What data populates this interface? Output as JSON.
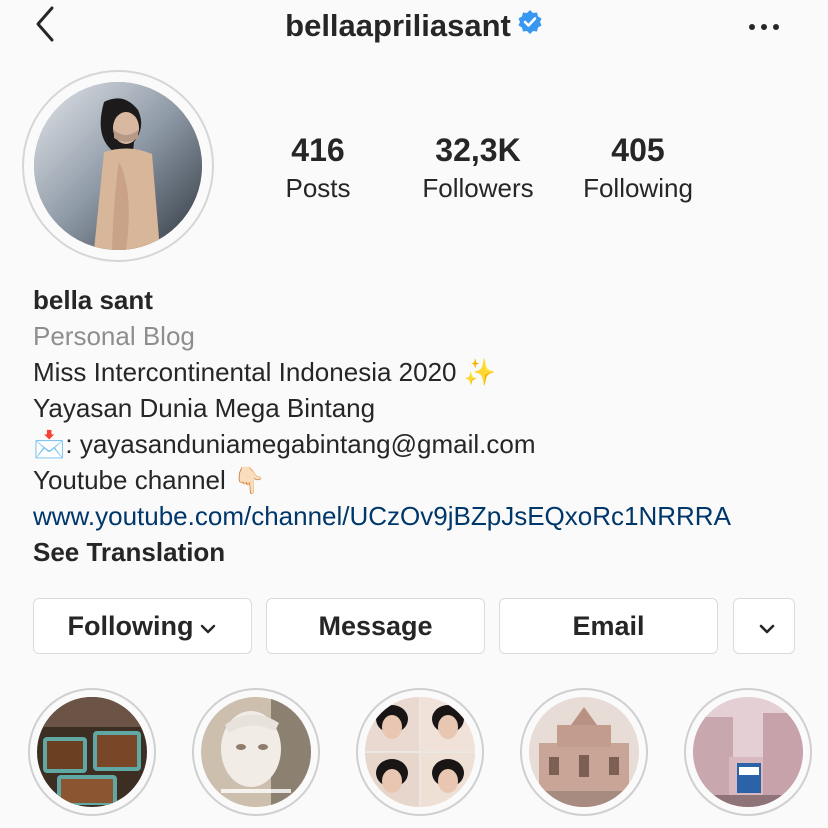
{
  "header": {
    "username": "bellaapriliasant",
    "back_icon": "chevron-left-icon",
    "verified_icon": "verified-badge-icon",
    "more_icon": "more-horizontal-icon",
    "accent_color": "#3897f0"
  },
  "stats": [
    {
      "value": "416",
      "label": "Posts"
    },
    {
      "value": "32,3K",
      "label": "Followers"
    },
    {
      "value": "405",
      "label": "Following"
    }
  ],
  "bio": {
    "name": "bella sant",
    "category": "Personal Blog",
    "line1": "Miss Intercontinental Indonesia 2020 ✨",
    "line2": "Yayasan Dunia Mega Bintang",
    "line3": "📩: yayasanduniamegabintang@gmail.com",
    "line4": "Youtube channel 👇🏻",
    "link": "www.youtube.com/channel/UCzOv9jBZpJsEQxoRc1NRRRA",
    "see_translation": "See Translation",
    "link_color": "#00376b",
    "category_color": "#8e8e8e"
  },
  "buttons": {
    "following": "Following",
    "message": "Message",
    "email": "Email",
    "suggest_icon": "chevron-down-icon"
  },
  "highlights": [
    {
      "icon": "food-photo"
    },
    {
      "icon": "face-mask-photo"
    },
    {
      "icon": "selfie-collage-photo"
    },
    {
      "icon": "ruins-photo"
    },
    {
      "icon": "street-photo"
    }
  ]
}
